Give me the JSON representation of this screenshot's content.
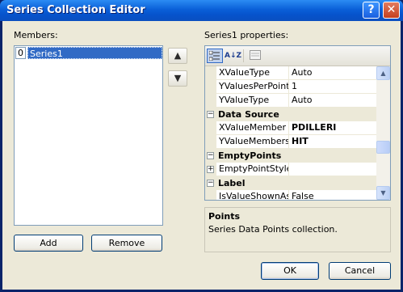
{
  "window": {
    "title": "Series Collection Editor",
    "help_label": "?",
    "close_label": "✕"
  },
  "members": {
    "label": "Members:",
    "items": [
      {
        "index": "0",
        "name": "Series1"
      }
    ],
    "move_up": "▲",
    "move_down": "▼",
    "add_label": "Add",
    "remove_label": "Remove"
  },
  "properties": {
    "label": "Series1 properties:",
    "toolbar": {
      "categorized_icon": "categorized-icon",
      "alphabetical_icon": "alphabetical-icon",
      "alphabetical_text": "A↓Z",
      "property_pages_icon": "property-pages-icon"
    },
    "rows": [
      {
        "kind": "prop",
        "name": "XValueType",
        "value": "Auto"
      },
      {
        "kind": "prop",
        "name": "YValuesPerPoint",
        "value": "1"
      },
      {
        "kind": "prop",
        "name": "YValueType",
        "value": "Auto"
      },
      {
        "kind": "cat",
        "name": "Data Source",
        "toggle": "−"
      },
      {
        "kind": "prop",
        "name": "XValueMember",
        "value": "PDILLERI",
        "bold": true
      },
      {
        "kind": "prop",
        "name": "YValueMembers",
        "value": "HIT",
        "bold": true
      },
      {
        "kind": "cat",
        "name": "EmptyPoints",
        "toggle": "−"
      },
      {
        "kind": "prop",
        "name": "EmptyPointStyle",
        "value": "",
        "expander": "+"
      },
      {
        "kind": "cat",
        "name": "Label",
        "toggle": "−"
      },
      {
        "kind": "prop",
        "name": "IsValueShownAsLabel",
        "value": "False"
      }
    ],
    "description": {
      "title": "Points",
      "text": "Series Data Points collection."
    }
  },
  "footer": {
    "ok_label": "OK",
    "cancel_label": "Cancel"
  }
}
